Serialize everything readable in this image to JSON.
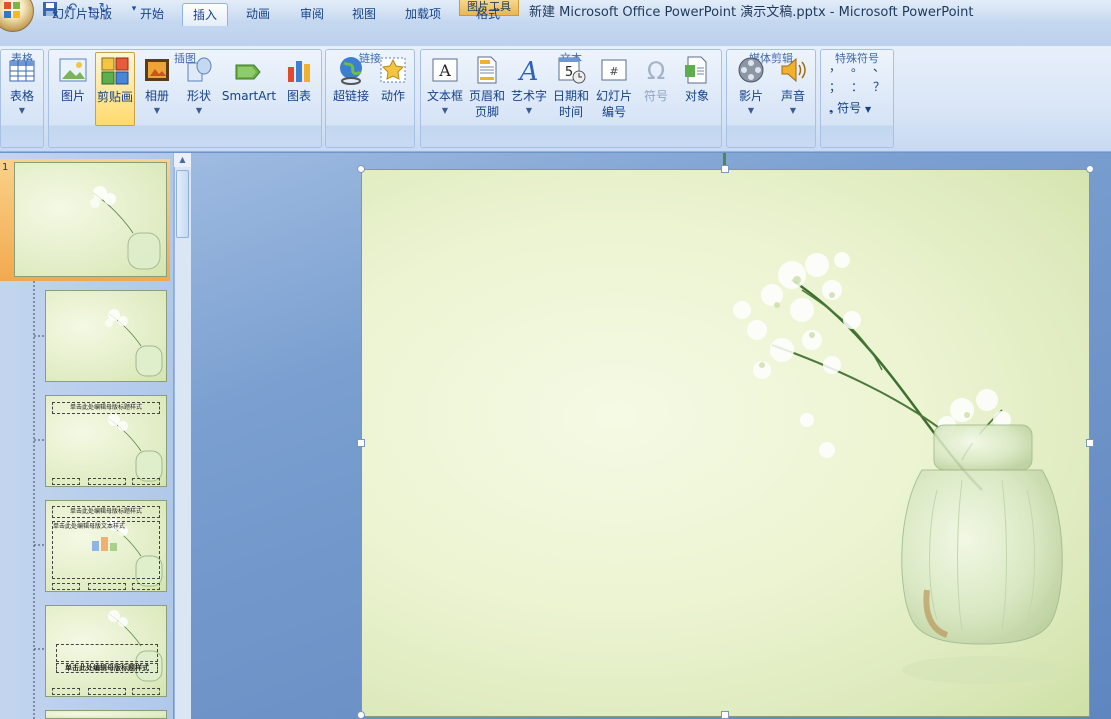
{
  "window": {
    "title": "新建 Microsoft Office PowerPoint 演示文稿.pptx - Microsoft PowerPoint",
    "contextual_tab_group": "图片工具"
  },
  "tabs": [
    {
      "label": "幻灯片母版"
    },
    {
      "label": "开始"
    },
    {
      "label": "插入",
      "active": true
    },
    {
      "label": "动画"
    },
    {
      "label": "审阅"
    },
    {
      "label": "视图"
    },
    {
      "label": "加载项"
    },
    {
      "label": "格式"
    }
  ],
  "ribbon": {
    "groups": {
      "tables": {
        "label": "表格",
        "buttons": {
          "table": "表格"
        }
      },
      "illustrations": {
        "label": "插图",
        "buttons": {
          "picture": "图片",
          "clipart": "剪贴画",
          "album": "相册",
          "shapes": "形状",
          "smartart": "SmartArt",
          "chart": "图表"
        }
      },
      "links": {
        "label": "链接",
        "buttons": {
          "hyperlink": "超链接",
          "action": "动作"
        }
      },
      "text": {
        "label": "文本",
        "buttons": {
          "textbox": "文本框",
          "header_footer": "页眉和\n页脚",
          "wordart": "艺术字",
          "datetime": "日期和\n时间",
          "slide_number": "幻灯片\n编号",
          "symbol": "符号",
          "object": "对象"
        }
      },
      "media": {
        "label": "媒体剪辑",
        "buttons": {
          "movie": "影片",
          "sound": "声音"
        }
      },
      "special": {
        "label": "特殊符号",
        "symbols": [
          "，",
          "。",
          "、",
          "；",
          "：",
          "？"
        ],
        "button": "符号"
      }
    }
  },
  "slides_panel": {
    "slide_number": "1",
    "placeholder_text": "单击此处编辑母版标题样式",
    "placeholder_text2": "单击此处编辑母版文本样式"
  },
  "colors": {
    "ribbon_bg": "#dbe7f7",
    "selection": "#f2a94e",
    "slide_bg": "#ecf4d2"
  }
}
